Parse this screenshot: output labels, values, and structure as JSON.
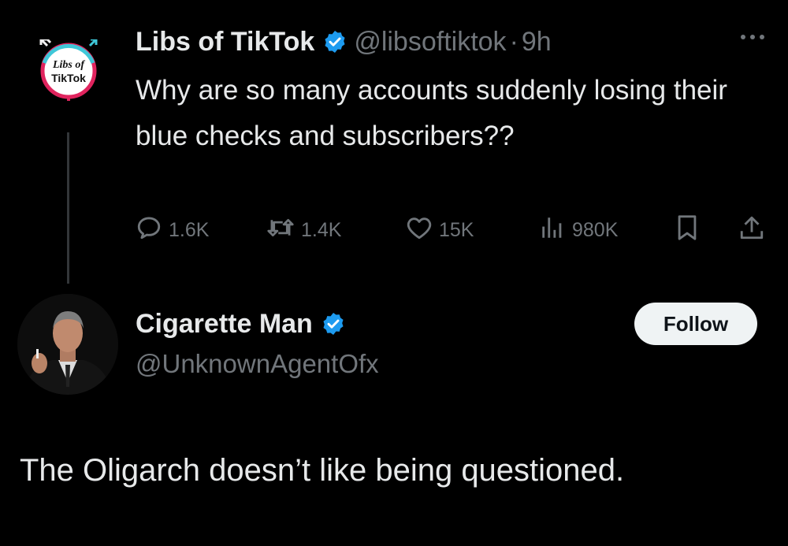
{
  "tweet": {
    "author": {
      "name": "Libs of TikTok",
      "handle": "@libsoftiktok",
      "separator": "·",
      "time": "9h",
      "avatar_text_line1": "Libs of",
      "avatar_text_line2": "TikTok"
    },
    "text": "Why are so many accounts suddenly losing their blue checks and subscribers??",
    "actions": {
      "replies": "1.6K",
      "reposts": "1.4K",
      "likes": "15K",
      "views": "980K"
    }
  },
  "reply": {
    "author": {
      "name": "Cigarette Man",
      "handle": "@UnknownAgentOfx"
    },
    "follow_label": "Follow",
    "text": "The Oligarch doesn’t like being questioned."
  },
  "colors": {
    "background": "#000000",
    "primary_text": "#e7e9ea",
    "secondary_text": "#71767b",
    "verified_blue": "#1d9bf0",
    "follow_bg": "#eff3f4"
  },
  "icons": [
    "verified-badge-icon",
    "more-options-icon",
    "reply-icon",
    "repost-icon",
    "like-icon",
    "views-icon",
    "bookmark-icon",
    "share-icon"
  ]
}
